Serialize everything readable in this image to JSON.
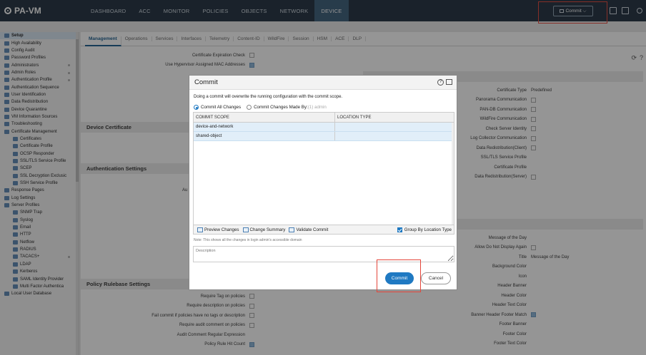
{
  "app": {
    "title": "PA-VM"
  },
  "nav": {
    "tabs": [
      "DASHBOARD",
      "ACC",
      "MONITOR",
      "POLICIES",
      "OBJECTS",
      "NETWORK",
      "DEVICE"
    ],
    "active": "DEVICE"
  },
  "topbar": {
    "commit_label": "Commit ⌵"
  },
  "sidebar": {
    "items": [
      "Setup",
      "High Availability",
      "Config Audit",
      "Password Profiles",
      "Administrators",
      "Admin Roles",
      "Authentication Profile",
      "Authentication Sequence",
      "User Identification",
      "Data Redistribution",
      "Device Quarantine",
      "VM Information Sources",
      "Troubleshooting",
      "Certificate Management",
      "Certificates",
      "Certificate Profile",
      "OCSP Responder",
      "SSL/TLS Service Profile",
      "SCEP",
      "SSL Decryption Exclusic",
      "SSH Service Profile",
      "Response Pages",
      "Log Settings",
      "Server Profiles",
      "SNMP Trap",
      "Syslog",
      "Email",
      "HTTP",
      "Netflow",
      "RADIUS",
      "TACACS+",
      "LDAP",
      "Kerberos",
      "SAML Identity Provider",
      "Multi Factor Authentica",
      "Local User Database"
    ],
    "selected": "Setup"
  },
  "subtabs": {
    "items": [
      "Management",
      "Operations",
      "Services",
      "Interfaces",
      "Telemetry",
      "Content-ID",
      "WildFire",
      "Session",
      "HSM",
      "ACE",
      "DLP"
    ],
    "active": "Management"
  },
  "left_fields_top": [
    {
      "label": "Certificate Expiration Check",
      "checked": false
    },
    {
      "label": "Use Hypervisor Assigned MAC Addresses",
      "checked": true
    }
  ],
  "panels": {
    "device_certificate": "Device Certificate",
    "auth_settings": "Authentication Settings",
    "policy_rulebase": "Policy Rulebase Settings"
  },
  "auth_partial": "Au",
  "policy_fields": [
    {
      "label": "Require Tag on policies",
      "checked": false
    },
    {
      "label": "Require description on policies",
      "checked": false
    },
    {
      "label": "Fail commit if policies have no tags or description",
      "checked": false
    },
    {
      "label": "Require audit comment on policies",
      "checked": false
    },
    {
      "label": "Audit Comment Regular Expression",
      "checked": null
    },
    {
      "label": "Policy Rule Hit Count",
      "checked": true
    }
  ],
  "right_fields_1": [
    {
      "label": "Certificate Type",
      "value": "Predefined"
    },
    {
      "label": "Panorama Communication",
      "checked": false
    },
    {
      "label": "PAN-DB Communication",
      "checked": false
    },
    {
      "label": "WildFire Communication",
      "checked": false
    },
    {
      "label": "Check Server Identity",
      "checked": false
    },
    {
      "label": "Log Collector Communication",
      "checked": false
    },
    {
      "label": "Data Redistribution(Client)",
      "checked": false
    },
    {
      "label": "SSL/TLS Service Profile",
      "value": ""
    },
    {
      "label": "Certificate Profile",
      "value": ""
    },
    {
      "label": "Data Redistribution(Server)",
      "checked": false
    }
  ],
  "right_fields_2": [
    {
      "label": "Message of the Day",
      "value": ""
    },
    {
      "label": "Allow Do Not Display Again",
      "checked": false
    },
    {
      "label": "Title",
      "value": "Message of the Day"
    },
    {
      "label": "Background Color",
      "value": ""
    },
    {
      "label": "Icon",
      "value": ""
    },
    {
      "label": "Header Banner",
      "value": ""
    },
    {
      "label": "Header Color",
      "value": ""
    },
    {
      "label": "Header Text Color",
      "value": ""
    },
    {
      "label": "Banner Header Footer Match",
      "checked": true
    },
    {
      "label": "Footer Banner",
      "value": ""
    },
    {
      "label": "Footer Color",
      "value": ""
    },
    {
      "label": "Footer Text Color",
      "value": ""
    }
  ],
  "modal": {
    "title": "Commit",
    "description": "Doing a commit will overwrite the running configuration with the commit scope.",
    "radio_all": "Commit All Changes",
    "radio_by": "Commit Changes Made By:",
    "radio_by_user": "(1) admin",
    "table": {
      "headers": [
        "COMMIT SCOPE",
        "LOCATION TYPE"
      ],
      "rows": [
        {
          "scope": "device-and-network",
          "location": ""
        },
        {
          "scope": "shared-object",
          "location": ""
        }
      ]
    },
    "actions": {
      "preview": "Preview Changes",
      "summary": "Change Summary",
      "validate": "Validate Commit"
    },
    "group_by_location": "Group By Location Type",
    "note": "Note: This shows all the changes in login admin's accessible domain",
    "desc_placeholder": "Description",
    "commit_button": "Commit",
    "cancel_button": "Cancel"
  },
  "colors": {
    "topbar": "#1f2f3e",
    "active_tab": "#3a5d79",
    "accent": "#1f79c2",
    "highlight": "#e4453a"
  }
}
